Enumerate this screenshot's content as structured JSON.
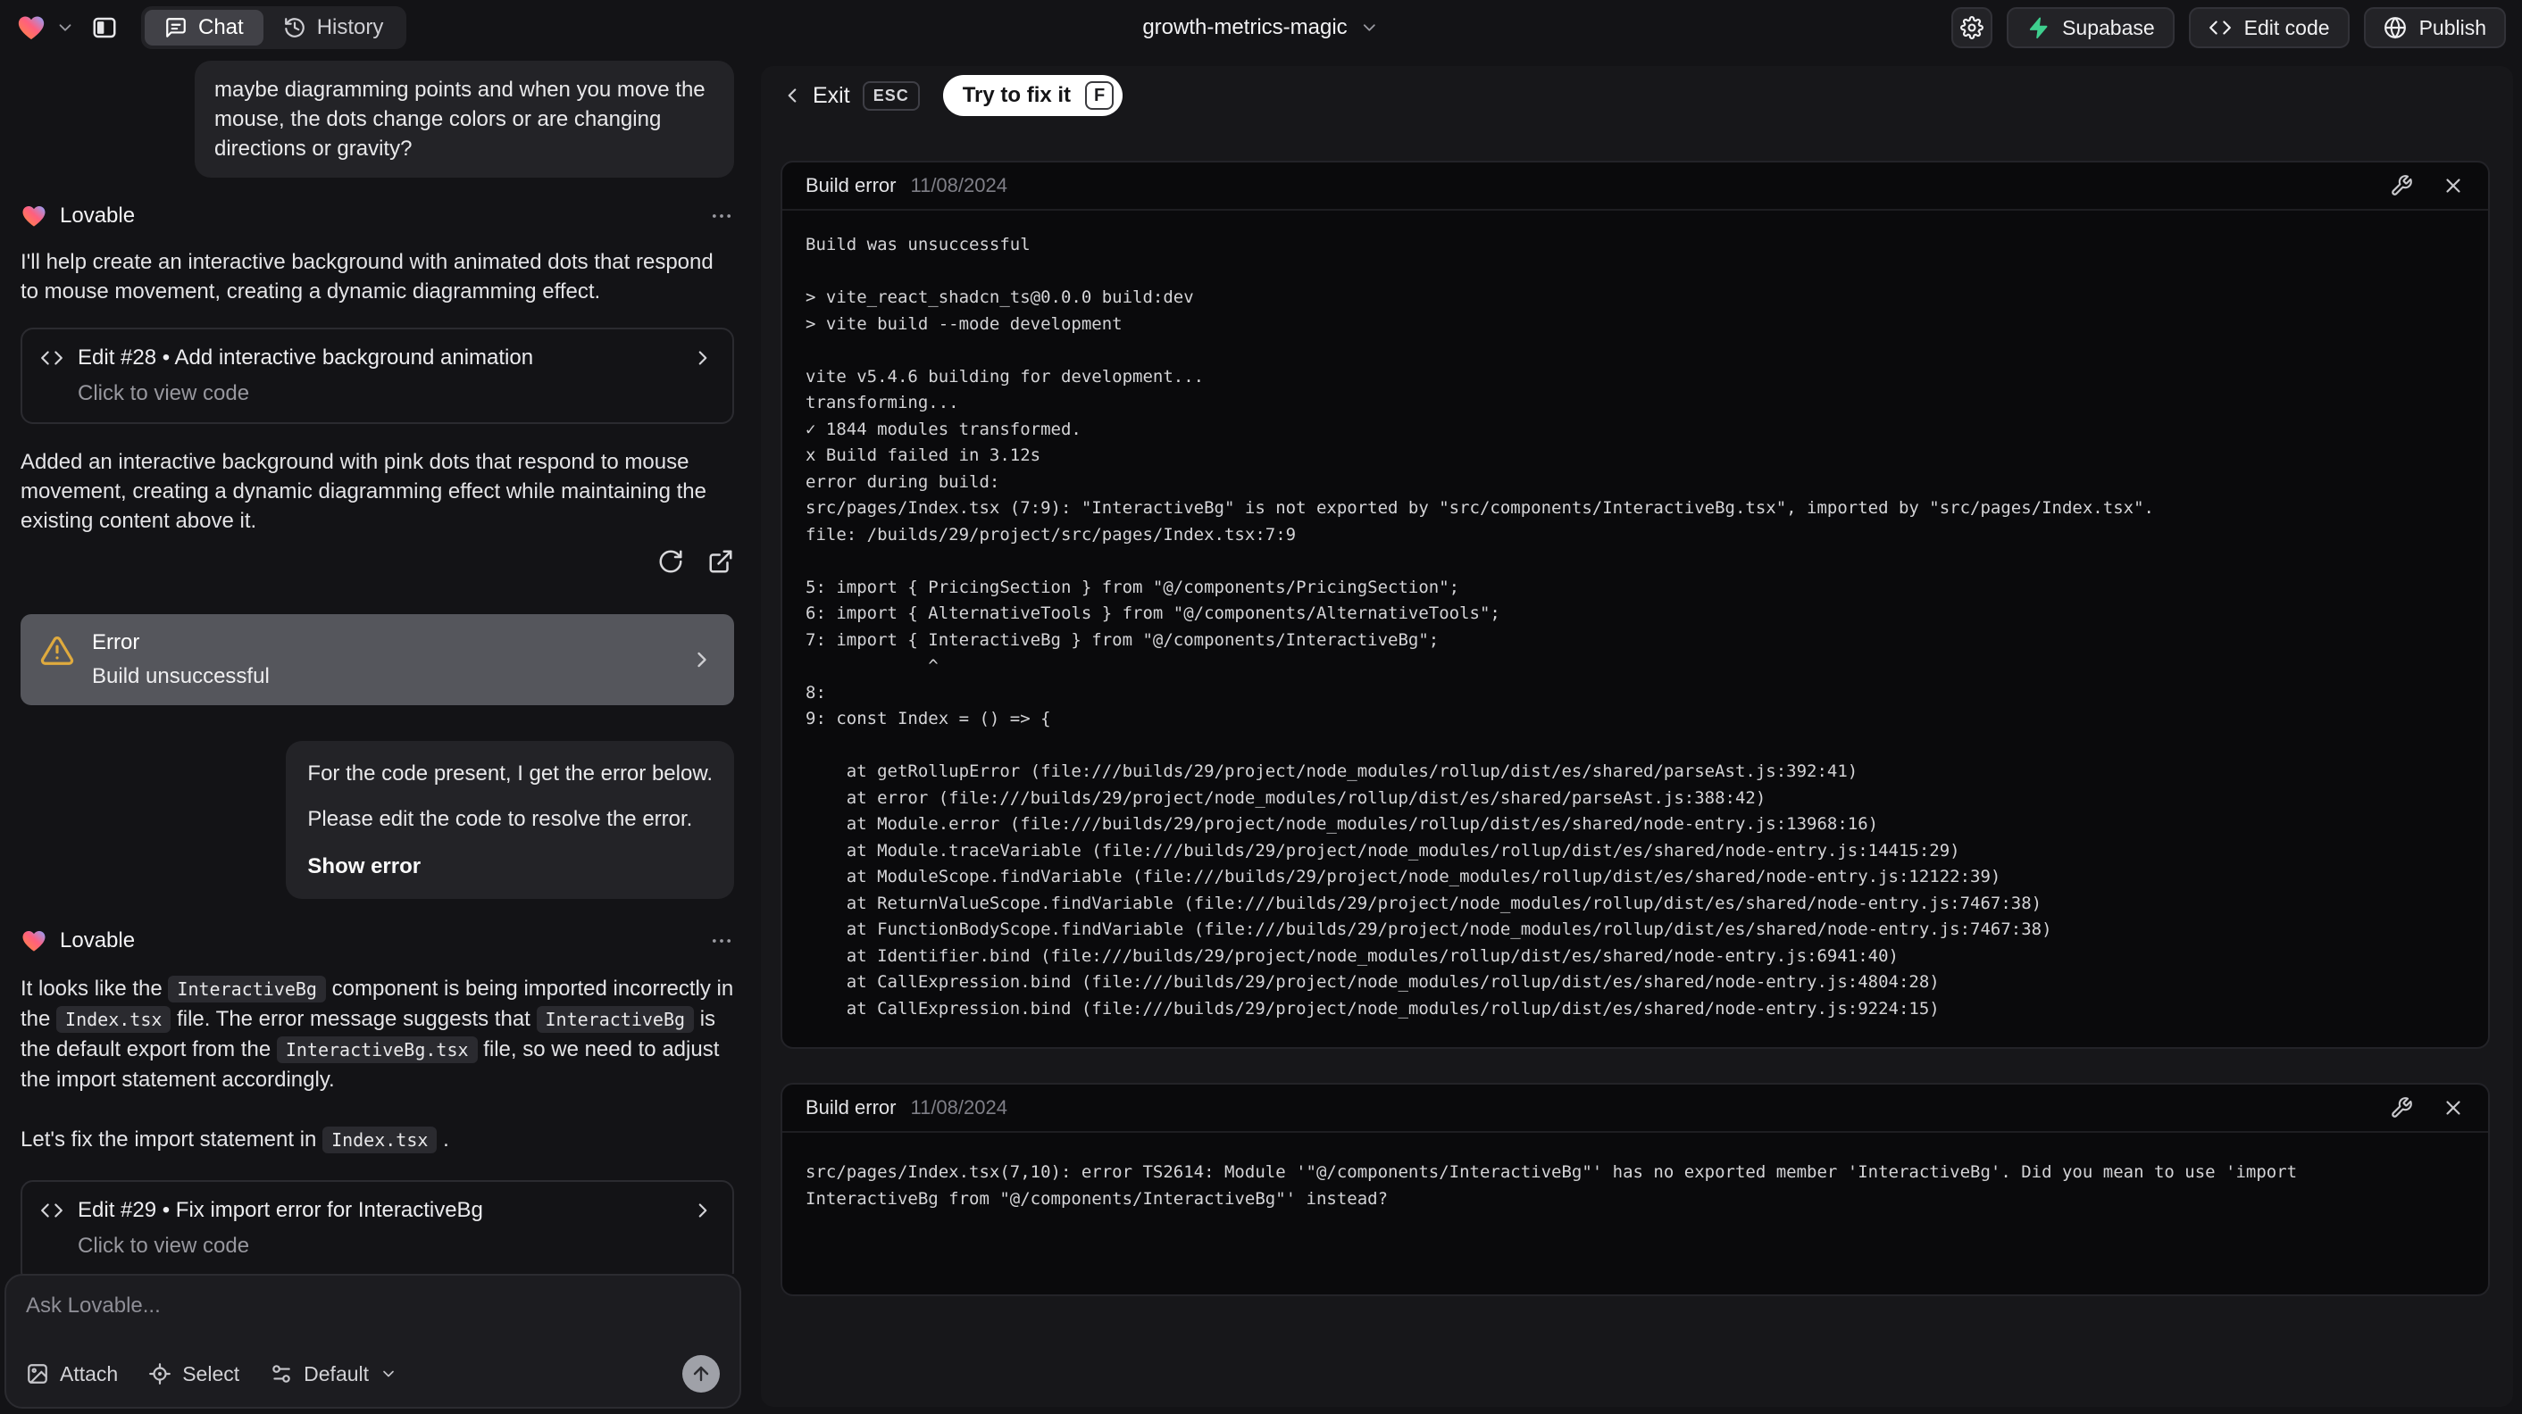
{
  "topbar": {
    "project_name": "growth-metrics-magic",
    "tabs": {
      "chat": "Chat",
      "history": "History"
    },
    "actions": {
      "supabase": "Supabase",
      "edit_code": "Edit code",
      "publish": "Publish"
    }
  },
  "chat": {
    "assistant_name": "Lovable",
    "user_message_1": "maybe diagramming points and when you move the mouse, the dots change colors or are changing directions or gravity?",
    "message_intro": "I'll help create an interactive background with animated dots that respond to mouse movement, creating a dynamic diagramming effect.",
    "edit_card_28": {
      "title": "Edit #28 • Add interactive background animation",
      "subtitle": "Click to view code"
    },
    "message_added": "Added an interactive background with pink dots that respond to mouse movement, creating a dynamic diagramming effect while maintaining the existing content above it.",
    "error_card": {
      "title": "Error",
      "subtitle": "Build unsuccessful"
    },
    "user_message_2": {
      "line1": "For the code present, I get the error below.",
      "line2": "Please edit the code to resolve the error.",
      "action": "Show error"
    },
    "message_fix": {
      "p1": [
        {
          "v": "It looks like the "
        },
        {
          "v": "InteractiveBg"
        },
        {
          "v": " component is being imported incorrectly in the "
        },
        {
          "v": "Index.tsx"
        },
        {
          "v": " file. The error message suggests that "
        },
        {
          "v": "InteractiveBg"
        },
        {
          "v": " is the default export from the "
        },
        {
          "v": "InteractiveBg.tsx"
        },
        {
          "v": " file, so we need to adjust the import statement accordingly."
        }
      ],
      "p2": [
        {
          "v": "Let's fix the import statement in "
        },
        {
          "v": "Index.tsx"
        },
        {
          "v": " ."
        }
      ]
    },
    "edit_card_29": {
      "title": "Edit #29 • Fix import error for InteractiveBg",
      "subtitle": "Click to view code"
    },
    "input": {
      "placeholder": "Ask Lovable...",
      "attach": "Attach",
      "select": "Select",
      "model": "Default"
    }
  },
  "error_view": {
    "exit_label": "Exit",
    "esc_key": "ESC",
    "fix_label": "Try to fix it",
    "fix_key": "F",
    "panels": [
      {
        "title": "Build error",
        "date": "11/08/2024",
        "log": "Build was unsuccessful\n\n> vite_react_shadcn_ts@0.0.0 build:dev\n> vite build --mode development\n\nvite v5.4.6 building for development...\ntransforming...\n✓ 1844 modules transformed.\nx Build failed in 3.12s\nerror during build:\nsrc/pages/Index.tsx (7:9): \"InteractiveBg\" is not exported by \"src/components/InteractiveBg.tsx\", imported by \"src/pages/Index.tsx\".\nfile: /builds/29/project/src/pages/Index.tsx:7:9\n\n5: import { PricingSection } from \"@/components/PricingSection\";\n6: import { AlternativeTools } from \"@/components/AlternativeTools\";\n7: import { InteractiveBg } from \"@/components/InteractiveBg\";\n            ^\n8:\n9: const Index = () => {\n\n    at getRollupError (file:///builds/29/project/node_modules/rollup/dist/es/shared/parseAst.js:392:41)\n    at error (file:///builds/29/project/node_modules/rollup/dist/es/shared/parseAst.js:388:42)\n    at Module.error (file:///builds/29/project/node_modules/rollup/dist/es/shared/node-entry.js:13968:16)\n    at Module.traceVariable (file:///builds/29/project/node_modules/rollup/dist/es/shared/node-entry.js:14415:29)\n    at ModuleScope.findVariable (file:///builds/29/project/node_modules/rollup/dist/es/shared/node-entry.js:12122:39)\n    at ReturnValueScope.findVariable (file:///builds/29/project/node_modules/rollup/dist/es/shared/node-entry.js:7467:38)\n    at FunctionBodyScope.findVariable (file:///builds/29/project/node_modules/rollup/dist/es/shared/node-entry.js:7467:38)\n    at Identifier.bind (file:///builds/29/project/node_modules/rollup/dist/es/shared/node-entry.js:6941:40)\n    at CallExpression.bind (file:///builds/29/project/node_modules/rollup/dist/es/shared/node-entry.js:4804:28)\n    at CallExpression.bind (file:///builds/29/project/node_modules/rollup/dist/es/shared/node-entry.js:9224:15)"
      },
      {
        "title": "Build error",
        "date": "11/08/2024",
        "log": "src/pages/Index.tsx(7,10): error TS2614: Module '\"@/components/InteractiveBg\"' has no exported member 'InteractiveBg'. Did you mean to use 'import\nInteractiveBg from \"@/components/InteractiveBg\"' instead?"
      }
    ]
  },
  "colors": {
    "supabase_green": "#3ecf8e",
    "warning_amber": "#dfaa3e",
    "error_card_bg": "#55565c",
    "panel_bg": "#0a0a0c"
  }
}
